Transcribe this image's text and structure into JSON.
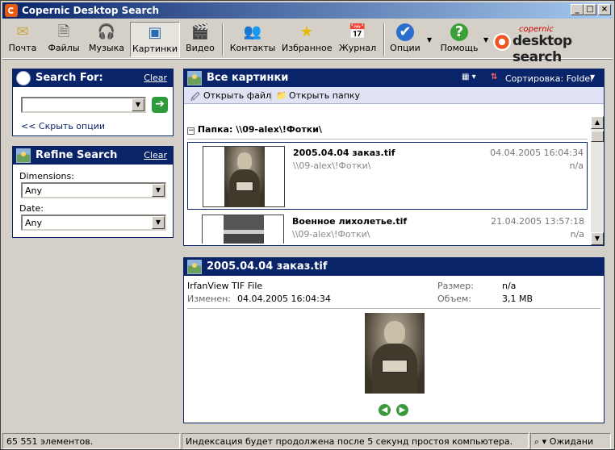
{
  "window": {
    "title": "Copernic Desktop Search"
  },
  "toolbar": {
    "items": [
      {
        "label": "Почта",
        "icon": "mail-icon"
      },
      {
        "label": "Файлы",
        "icon": "document-icon"
      },
      {
        "label": "Музыка",
        "icon": "headphones-icon"
      },
      {
        "label": "Картинки",
        "icon": "picture-icon"
      },
      {
        "label": "Видео",
        "icon": "clapperboard-icon"
      },
      {
        "label": "Контакты",
        "icon": "contacts-icon"
      },
      {
        "label": "Избранное",
        "icon": "star-icon"
      },
      {
        "label": "Журнал",
        "icon": "calendar-icon"
      },
      {
        "label": "Опции",
        "icon": "checkmark-icon"
      },
      {
        "label": "Помощь",
        "icon": "help-icon"
      }
    ],
    "logo_small": "copernic",
    "logo_big": "desktop search"
  },
  "search_for": {
    "title": "Search For:",
    "clear": "Clear",
    "query_value": "",
    "hide_options": "<< Скрыть опции"
  },
  "refine": {
    "title": "Refine Search",
    "clear": "Clear",
    "dimensions_label": "Dimensions:",
    "dimensions_value": "Any",
    "date_label": "Date:",
    "date_value": "Any"
  },
  "results": {
    "title": "Все картинки",
    "sort_label": "Сортировка: Folder",
    "open_file": "Открыть файл",
    "open_folder": "Открыть папку",
    "folder_header": "Папка: \\\\09-alex\\!Фотки\\",
    "items": [
      {
        "name": "2005.04.04 заказ.tif",
        "path": "\\\\09-alex\\!Фотки\\",
        "date": "04.04.2005 16:04:34",
        "size": "n/a"
      },
      {
        "name": "Военное лихолетье.tif",
        "path": "\\\\09-alex\\!Фотки\\",
        "date": "21.04.2005 13:57:18",
        "size": "n/a"
      }
    ]
  },
  "preview": {
    "title": "2005.04.04 заказ.tif",
    "type": "IrfanView TIF File",
    "modified_label": "Изменен:",
    "modified_value": "04.04.2005 16:04:34",
    "size_label": "Размер:",
    "size_value": "n/a",
    "volume_label": "Объем:",
    "volume_value": "3,1 MB"
  },
  "status": {
    "count": "65 551 элементов.",
    "message": "Индексация будет продолжена после 5 секунд простоя компьютера.",
    "state": "Ожидани"
  }
}
